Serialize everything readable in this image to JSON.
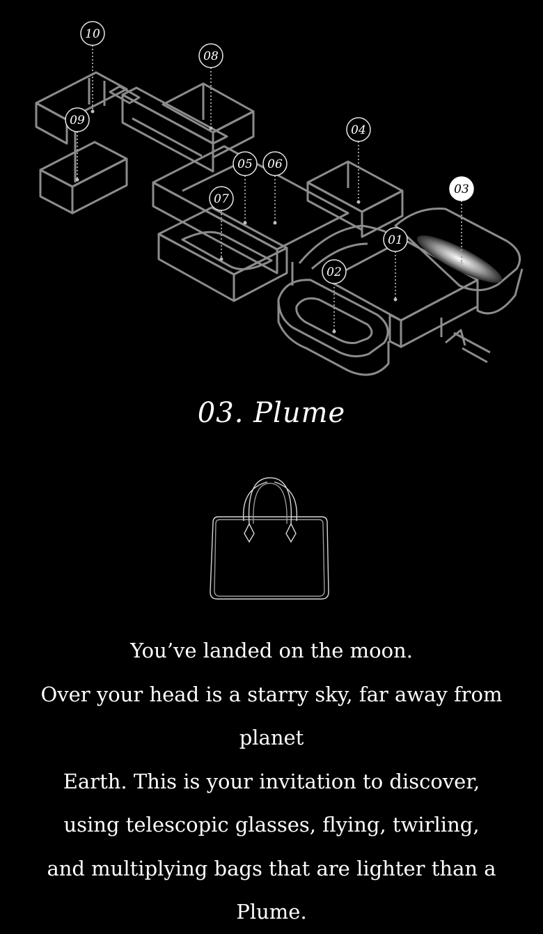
{
  "map": {
    "active_room": "03",
    "rooms": [
      {
        "number": "01",
        "active": false
      },
      {
        "number": "02",
        "active": false
      },
      {
        "number": "03",
        "active": true
      },
      {
        "number": "04",
        "active": false
      },
      {
        "number": "05",
        "active": false
      },
      {
        "number": "06",
        "active": false
      },
      {
        "number": "07",
        "active": false
      },
      {
        "number": "08",
        "active": false
      },
      {
        "number": "09",
        "active": false
      },
      {
        "number": "10",
        "active": false
      }
    ],
    "entrance_icon": "arrow-icon"
  },
  "room_title": "03. Plume",
  "product_icon": "handbag-icon",
  "description": [
    "You’ve landed on the moon.",
    "Over your head is a starry sky, far away from planet",
    "Earth. This is your invitation to discover,",
    "using telescopic glasses, flying, twirling,",
    "and multiplying bags that are lighter than a Plume."
  ],
  "colors": {
    "background": "#000000",
    "outline": "#8c8c8c",
    "text": "#ffffff",
    "active_pin": "#ffffff"
  }
}
